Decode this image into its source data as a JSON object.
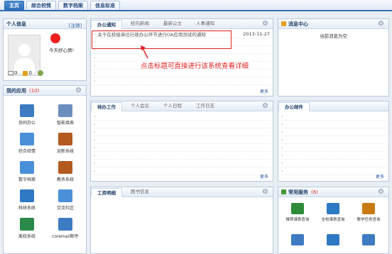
{
  "nav": {
    "tabs": [
      "主页",
      "综合校情",
      "数字档案",
      "信息标准"
    ]
  },
  "personal": {
    "title": "个人信息",
    "logout": "[注销]",
    "greeting": "今天好心情!",
    "counters": [
      "0",
      "0",
      ""
    ]
  },
  "apps": {
    "title": "我的应用",
    "count": "(10)",
    "items": [
      {
        "label": "协同办公",
        "color": "#3d7bc2"
      },
      {
        "label": "智能填表",
        "color": "#6c8ebf"
      },
      {
        "label": "综合校情",
        "color": "#4a90d9"
      },
      {
        "label": "迎新系统",
        "color": "#b35a1f"
      },
      {
        "label": "数字档案",
        "color": "#4a90d9"
      },
      {
        "label": "教务系统",
        "color": "#b35a1f"
      },
      {
        "label": "科研系统",
        "color": "#2f78c4"
      },
      {
        "label": "交流社区",
        "color": "#4a90d9"
      },
      {
        "label": "离校系统",
        "color": "#2a8a4a"
      },
      {
        "label": "coremail邮件",
        "color": "#3d7bc2"
      }
    ]
  },
  "office": {
    "tabs": [
      "办公通知",
      "校内新闻",
      "最新公文",
      "人事通知"
    ],
    "rows": [
      {
        "text": "关于在校级单位行政办公环节进行OA应用测试的通知",
        "date": "2013-11-27"
      },
      {
        "text": "",
        "date": ""
      },
      {
        "text": "",
        "date": ""
      },
      {
        "text": "",
        "date": ""
      },
      {
        "text": "",
        "date": ""
      },
      {
        "text": "",
        "date": ""
      },
      {
        "text": "",
        "date": ""
      }
    ],
    "more": "更多"
  },
  "annotation": "点击标题可直接进行该系统查看详细",
  "messages": {
    "title": "消息中心",
    "empty": "当前消息为空"
  },
  "todo": {
    "tabs": [
      "待办工作",
      "个人会议",
      "个人日程",
      "工作日志"
    ],
    "more": "更多"
  },
  "mail": {
    "title": "办公邮件",
    "more": "更多"
  },
  "salary": {
    "tabs": [
      "工资明细",
      "图书信息"
    ]
  },
  "services": {
    "title": "常用服务",
    "count": "(6)",
    "items": [
      {
        "label": "推荐课表查询",
        "color": "#2e8b3a"
      },
      {
        "label": "全校课表查询",
        "color": "#2f78c4"
      },
      {
        "label": "教学任务查询",
        "color": "#c87a12"
      },
      {
        "label": "",
        "color": "#3d7bc2"
      },
      {
        "label": "",
        "color": "#2f78c4"
      },
      {
        "label": "",
        "color": "#3d7bc2"
      }
    ]
  }
}
